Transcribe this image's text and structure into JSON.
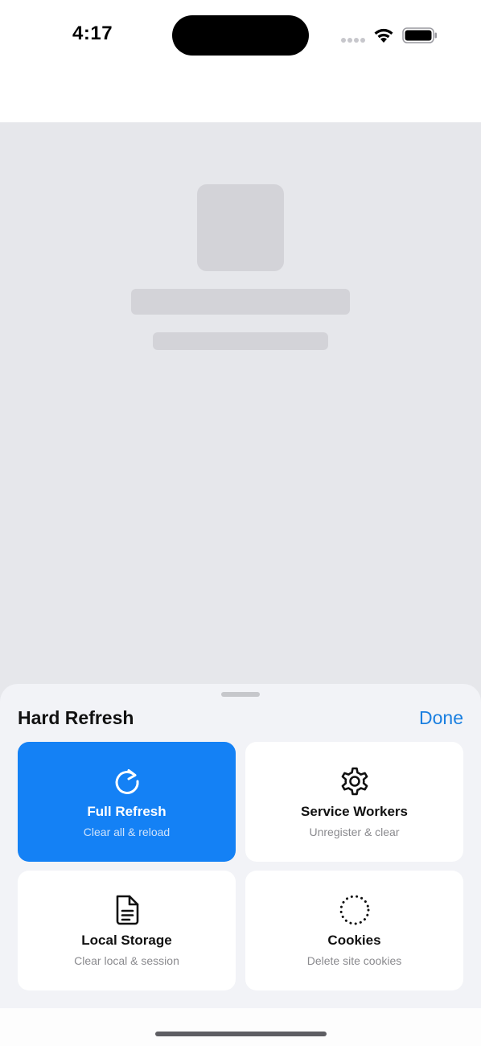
{
  "status_bar": {
    "time": "4:17",
    "icons": [
      "cellular-dots-icon",
      "wifi-icon",
      "battery-icon"
    ]
  },
  "sheet": {
    "title": "Hard Refresh",
    "done_label": "Done",
    "accent_color": "#1481f5",
    "actions": [
      {
        "label": "Full Refresh",
        "subtitle": "Clear all & reload",
        "icon": "refresh-icon",
        "selected": true
      },
      {
        "label": "Service Workers",
        "subtitle": "Unregister & clear",
        "icon": "gear-icon",
        "selected": false
      },
      {
        "label": "Local Storage",
        "subtitle": "Clear local & session",
        "icon": "document-icon",
        "selected": false
      },
      {
        "label": "Cookies",
        "subtitle": "Delete site cookies",
        "icon": "dotted-circle-icon",
        "selected": false
      }
    ]
  }
}
